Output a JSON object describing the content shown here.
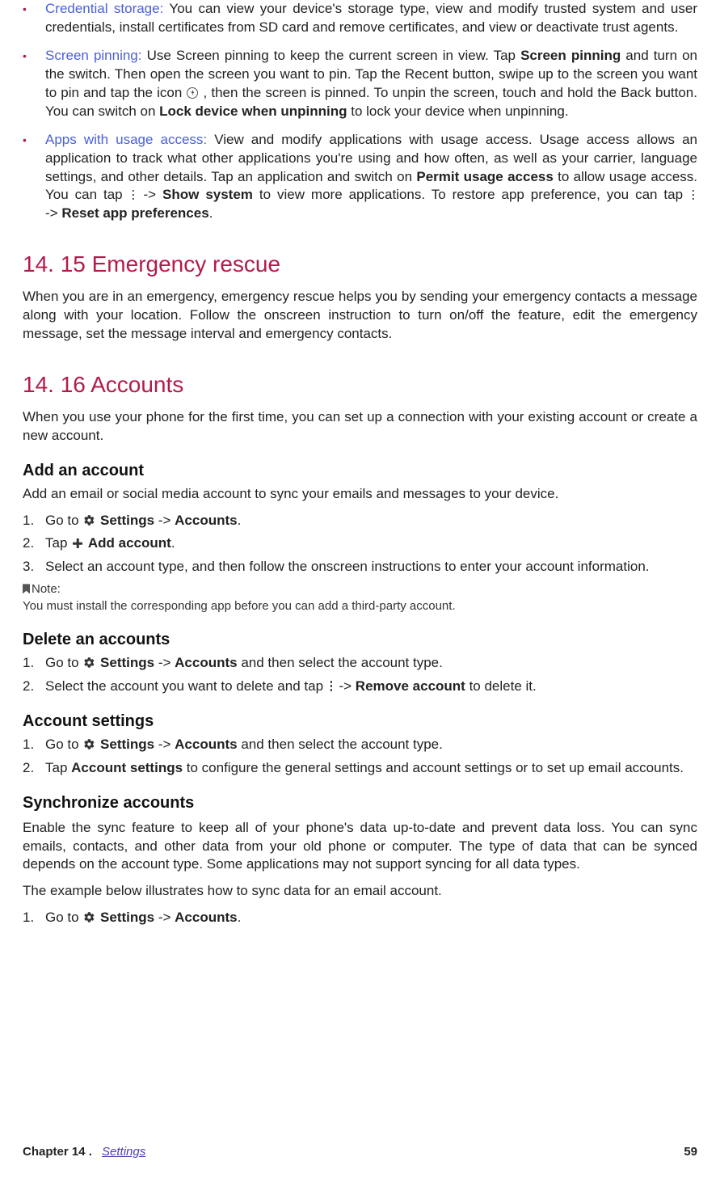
{
  "bullets": [
    {
      "topic": "Credential storage:",
      "text": " You can view your device's storage type, view and modify trusted system and user credentials, install certificates from SD card and remove certificates, and view or deactivate trust agents."
    },
    {
      "topic": "Screen pinning:",
      "p1": " Use Screen pinning to keep the current screen in view. Tap ",
      "b1": "Screen pinning",
      "p2": " and turn on the  switch. Then open the screen you want to pin. Tap the Recent button, swipe up to the screen you want to pin and tap the icon ",
      "p3": " , then the screen is pinned. To unpin the screen, touch and hold the Back button. You can switch on ",
      "b2": "Lock device when unpinning",
      "p4": " to lock your device when unpinning."
    },
    {
      "topic": "Apps with usage access:",
      "p1": " View and modify applications with usage access. Usage access allows an application to track what other applications you're using and how often, as well as your carrier, language settings, and other details. Tap an application and switch on ",
      "b1": "Permit usage access",
      "p2": " to allow usage access. You can tap ",
      "arrow1": " -> ",
      "b2": "Show system",
      "p3": " to view more applications. To restore app preference, you can tap ",
      "arrow2": " -> ",
      "b3": "Reset app preferences",
      "p4": "."
    }
  ],
  "s15": {
    "heading": "14. 15  Emergency rescue",
    "body": "When you are in an emergency, emergency rescue helps you by sending your emergency contacts a message along with your location. Follow the onscreen instruction to turn on/off the feature, edit the emergency message, set the message interval and emergency contacts."
  },
  "s16": {
    "heading": "14. 16  Accounts",
    "intro": "When you use your phone for the first time, you can set up a connection with your existing account or create a new account.",
    "add": {
      "title": "Add an account",
      "lead": "Add an email or social media account to sync your emails and messages to your device.",
      "step1_a": "Go to ",
      "step1_b": "Settings",
      "step1_c": " -> ",
      "step1_d": "Accounts",
      "step1_e": ".",
      "step2_a": "Tap  ",
      "step2_b": "Add account",
      "step2_c": ".",
      "step3": "Select an account type, and then follow the onscreen instructions to enter your account information.",
      "note_label": "Note:",
      "note_text": "You must install the corresponding app before you can add a third-party account."
    },
    "del": {
      "title": "Delete an accounts",
      "step1_a": "Go to ",
      "step1_b": "Settings",
      "step1_c": " -> ",
      "step1_d": "Accounts",
      "step1_e": " and then select the account type.",
      "step2_a": "Select the account you want to delete and tap ",
      "step2_b": " -> ",
      "step2_c": "Remove account",
      "step2_d": " to delete it."
    },
    "set": {
      "title": "Account settings",
      "step1_a": "Go to ",
      "step1_b": "Settings",
      "step1_c": " -> ",
      "step1_d": "Accounts",
      "step1_e": " and then select the account type.",
      "step2_a": "Tap ",
      "step2_b": "Account settings",
      "step2_c": " to configure the general settings and account settings or to set up email accounts."
    },
    "sync": {
      "title": "Synchronize accounts",
      "p1": "Enable the sync feature to keep all of your phone's data up-to-date and prevent data loss. You can sync emails, contacts, and other data from your old phone or computer. The type of data that can be synced depends on the account type. Some applications may not support syncing for all data types.",
      "p2": "The example below illustrates how to sync data for an email account.",
      "step1_a": "Go to ",
      "step1_b": "Settings",
      "step1_c": " -> ",
      "step1_d": "Accounts",
      "step1_e": "."
    }
  },
  "footer": {
    "chapter": "Chapter 14 .",
    "link": "Settings",
    "page": "59"
  },
  "numbers": {
    "n1": "1.",
    "n2": "2.",
    "n3": "3."
  }
}
